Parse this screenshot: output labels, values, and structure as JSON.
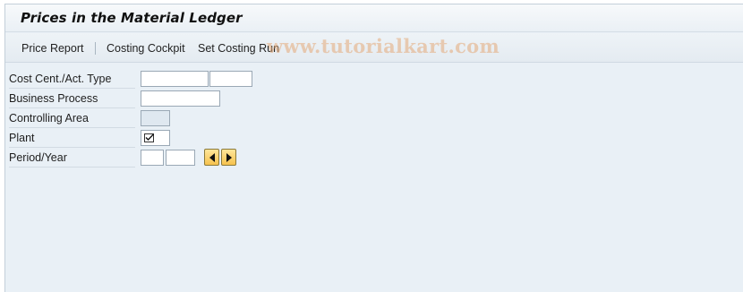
{
  "window": {
    "title": "Prices in the Material Ledger"
  },
  "toolbar": {
    "items": [
      {
        "label": "Price Report"
      },
      {
        "label": "Costing Cockpit"
      },
      {
        "label": "Set Costing Run"
      }
    ]
  },
  "watermark": "www.tutorialkart.com",
  "form": {
    "cost_center_label": "Cost Cent./Act. Type",
    "cost_center_value": "",
    "activity_type_value": "",
    "business_process_label": "Business Process",
    "business_process_value": "",
    "controlling_area_label": "Controlling Area",
    "controlling_area_value": "",
    "plant_label": "Plant",
    "plant_checked": true,
    "period_year_label": "Period/Year",
    "period_value": "",
    "year_value": ""
  },
  "icons": {
    "plant_check": "checkbox-checked-icon",
    "prev": "triangle-left-icon",
    "next": "triangle-right-icon"
  }
}
